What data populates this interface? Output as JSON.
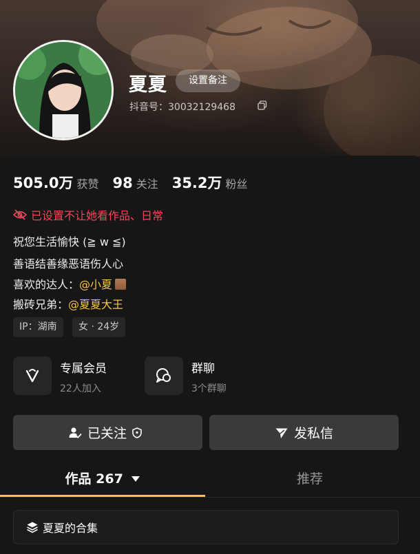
{
  "profile": {
    "nickname": "夏夏",
    "remark_button": "设置备注",
    "douyin_id": "抖音号：30032129468"
  },
  "stats": [
    {
      "num": "505.0万",
      "label": "获赞"
    },
    {
      "num": "98",
      "label": "关注"
    },
    {
      "num": "35.2万",
      "label": "粉丝"
    }
  ],
  "notice": "已设置不让她看作品、日常",
  "bio": {
    "line1": "祝您生活愉快 (≧ w ≦)",
    "line2": "善语结善缘恶语伤人心",
    "line3_prefix": "喜欢的达人：",
    "line3_mention": "@小夏",
    "line4_prefix": "搬砖兄弟：",
    "line4_mention": "@夏夏大王"
  },
  "tags": [
    "IP：湖南",
    "女 · 24岁"
  ],
  "features": [
    {
      "title": "专属会员",
      "sub": "22人加入",
      "icon": "v-badge-icon"
    },
    {
      "title": "群聊",
      "sub": "3个群聊",
      "icon": "chat-bubble-icon"
    }
  ],
  "actions": {
    "followed": "已关注",
    "message": "发私信"
  },
  "tabs": {
    "works": "作品 267",
    "recommend": "推荐"
  },
  "collection": "夏夏的合集",
  "colors": {
    "accent": "#f5c451",
    "warning": "#f2465b",
    "background": "#161616"
  }
}
